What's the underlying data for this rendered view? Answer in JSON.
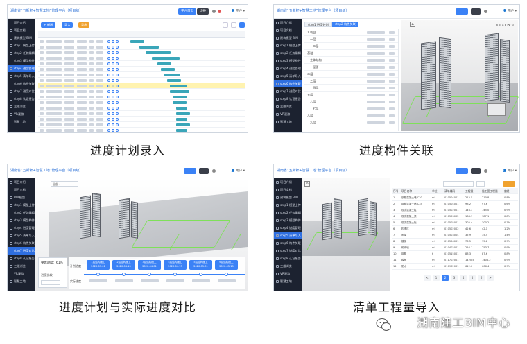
{
  "panels": [
    {
      "caption": "进度计划录入",
      "title": "湖南省“五新杯+智慧工地”管理平台（项目级）",
      "buttons": [
        "+ 新增",
        "导入",
        "导出"
      ],
      "top_buttons": [
        "平台首页",
        "切换"
      ],
      "sidebar": [
        "项目介绍",
        "项目文档",
        "建筑模型 BIM",
        "step1 模型上传",
        "step2 任务编辑",
        "step3 模型构件",
        "step4 进度管理",
        "step5 清单导入",
        "step6 构件关联",
        "step7 进度对比",
        "step8 认证报告",
        "三维浏览",
        "VR漫游",
        "智慧工地"
      ],
      "active_sidebar_index": 6
    },
    {
      "caption": "进度构件关联",
      "title": "湖南省“五新杯+智慧工地”管理平台（项目级）",
      "tabs": [
        "step1 进度计划",
        "step2 构件关联"
      ],
      "sidebar": [
        "项目介绍",
        "项目文档",
        "建筑模型 BIM",
        "step1 模型上传",
        "step2 任务编辑",
        "step3 模型构件",
        "step4 进度管理",
        "step5 清单导入",
        "step6 构件关联",
        "step7 进度对比",
        "step8 认证报告",
        "三维浏览",
        "VR漫游",
        "智慧工地"
      ],
      "active_sidebar_index": 8,
      "list_items": [
        "1 项目",
        "一层",
        "二层",
        "基础",
        "主体结构",
        "屋面",
        "二层",
        "三层",
        "四层",
        "五层",
        "六层",
        "七层",
        "八层",
        "九层"
      ]
    },
    {
      "caption": "进度计划与实际进度对比",
      "title": "湖南省“五新杯+智慧工地”管理平台（项目级）",
      "progress_label": "整体进度：61%",
      "progress_value": 0.61,
      "progress_sub": "进度比较",
      "timeline_label_plan": "计划进度",
      "timeline_label_actual": "实际进度",
      "timeline_cards": [
        "1层结构施工 2020.03.01",
        "2层结构施工 2020.03.15",
        "3层结构施工 2020.04.01",
        "4层结构施工 2020.04.15",
        "5层结构施工 2020.05.01",
        "6层结构施工 2020.05.15"
      ],
      "sidebar": [
        "项目介绍",
        "项目文档",
        "BIM模型",
        "step1 模型上传",
        "step2 任务编辑",
        "step3 模型构件",
        "step4 进度管理",
        "step5 清单导入",
        "step6 构件关联",
        "step7 进度对比",
        "step8 认证报告",
        "三维浏览",
        "VR漫游",
        "智慧工地"
      ],
      "active_sidebar_index": 9
    },
    {
      "caption": "清单工程量导入",
      "title": "湖南省“五新杯+智慧工地”管理平台（项目级）",
      "sidebar": [
        "项目介绍",
        "项目文档",
        "建筑模型 BIM",
        "step1 模型上传",
        "step2 任务编辑",
        "step3 模型构件",
        "step4 进度管理",
        "step5 清单导入",
        "step6 构件关联",
        "step7 进度对比",
        "step8 认证报告",
        "三维浏览",
        "VR漫游",
        "智慧工地"
      ],
      "active_sidebar_index": 7,
      "table_headers": [
        "序号",
        "项目名称",
        "单位",
        "清单编码",
        "工程量",
        "施工图工程量",
        "偏差"
      ],
      "table_rows": [
        [
          "1",
          "钢筋混凝土墙 C30",
          "m³",
          "010504001",
          "212.5",
          "210.8",
          "0.8%"
        ],
        [
          "2",
          "钢筋混凝土墙 C35",
          "m³",
          "010504001",
          "98.2",
          "97.6",
          "0.6%"
        ],
        [
          "3",
          "现浇混凝土柱",
          "m³",
          "010502001",
          "146.3",
          "145.0",
          "0.9%"
        ],
        [
          "4",
          "现浇混凝土梁",
          "m³",
          "010503002",
          "188.7",
          "187.1",
          "0.8%"
        ],
        [
          "5",
          "现浇混凝土板",
          "m³",
          "010505001",
          "302.4",
          "300.2",
          "0.7%"
        ],
        [
          "6",
          "构造柱",
          "m³",
          "010502002",
          "42.6",
          "42.1",
          "1.2%"
        ],
        [
          "7",
          "圈梁",
          "m³",
          "010503004",
          "35.9",
          "35.4",
          "1.4%"
        ],
        [
          "8",
          "楼梯",
          "m²",
          "010506001",
          "76.5",
          "75.8",
          "0.9%"
        ],
        [
          "9",
          "砌块墙",
          "m³",
          "010402001",
          "256.1",
          "253.7",
          "0.9%"
        ],
        [
          "10",
          "钢筋",
          "t",
          "010515001",
          "88.3",
          "87.6",
          "0.8%"
        ],
        [
          "11",
          "模板",
          "m²",
          "011702001",
          "1420.5",
          "1408.2",
          "0.9%"
        ],
        [
          "12",
          "防水",
          "m²",
          "010902001",
          "612.0",
          "606.4",
          "0.9%"
        ]
      ],
      "pagination": [
        "<",
        "1",
        "2",
        "3",
        "4",
        "5",
        "6",
        ">"
      ]
    }
  ],
  "watermark": "湖南建工BIM中心",
  "colors": {
    "accent": "#3b82f6",
    "sidebar": "#1c2230",
    "highlight": "#fff3b0",
    "green": "#7fe05a"
  }
}
